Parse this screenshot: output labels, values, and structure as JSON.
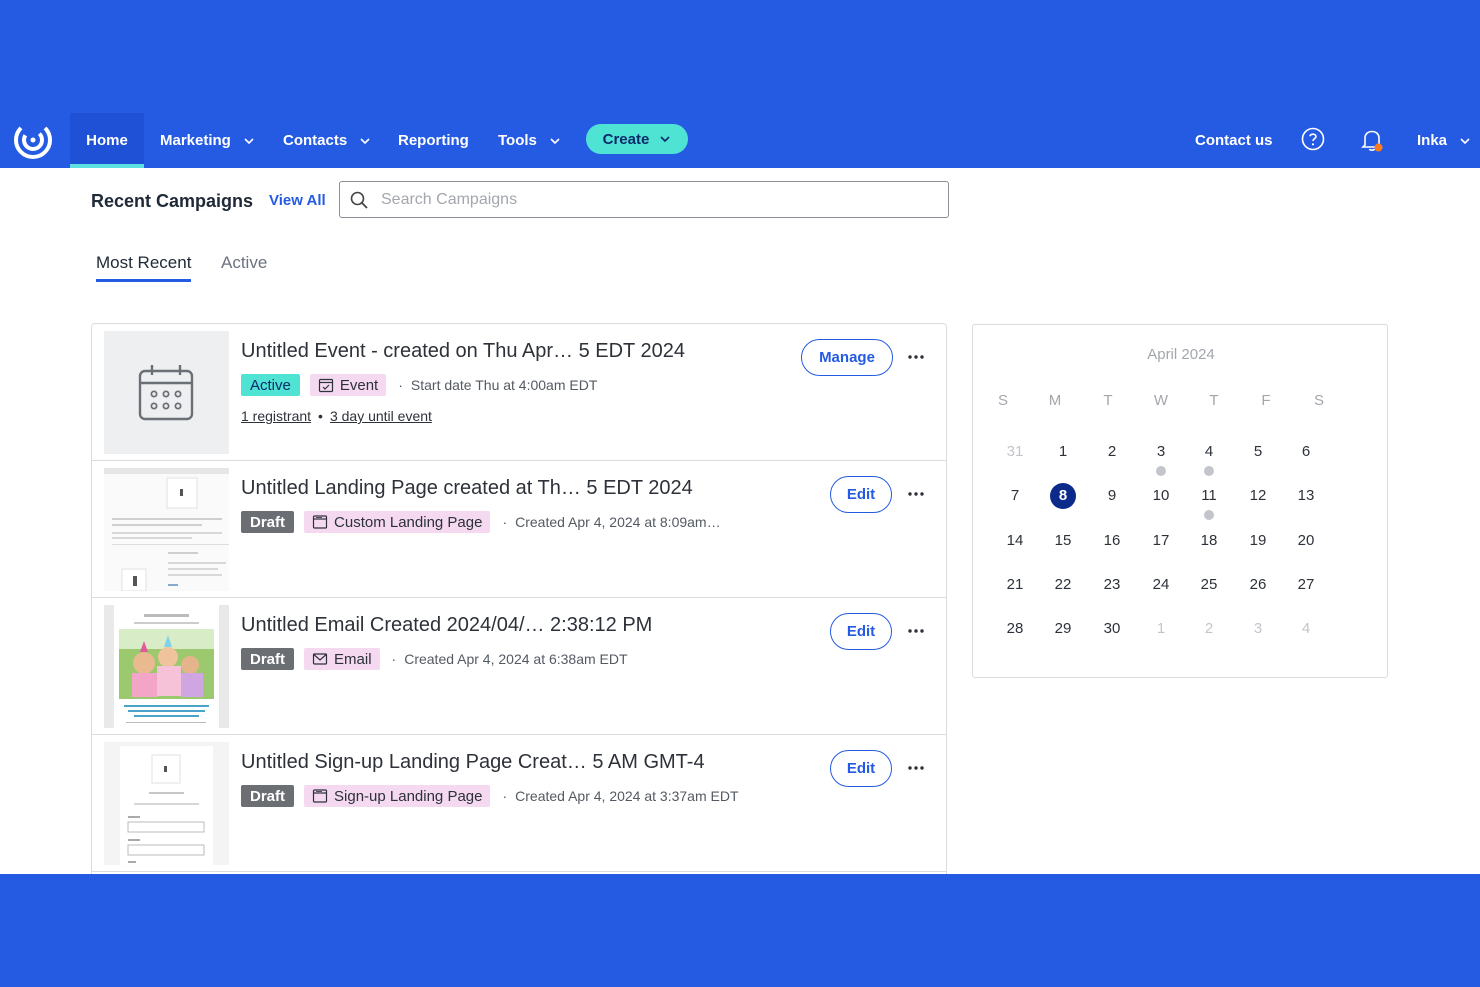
{
  "colors": {
    "brand": "#255be3",
    "accent": "#4fe3d4",
    "today": "#0b2a8a",
    "type_badge": "#f4d9f0",
    "draft_badge": "#6b6e73"
  },
  "nav": {
    "home": "Home",
    "marketing": "Marketing",
    "contacts": "Contacts",
    "reporting": "Reporting",
    "tools": "Tools",
    "create": "Create",
    "contact_us": "Contact us",
    "user": "Inka"
  },
  "recent": {
    "title": "Recent Campaigns",
    "view_all": "View All",
    "search_placeholder": "Search Campaigns"
  },
  "tabs": {
    "most_recent": "Most Recent",
    "active": "Active"
  },
  "campaigns": [
    {
      "title": "Untitled Event - created on Thu Apr… 5 EDT 2024",
      "status": "Active",
      "type": "Event",
      "type_icon": "calendar-check-icon",
      "meta": "Start date Thu at 4:00am EDT",
      "registrants": "1 registrant",
      "until": "3 day until event",
      "action": "Manage"
    },
    {
      "title": "Untitled Landing Page created at Th…  5 EDT 2024",
      "status": "Draft",
      "type": "Custom Landing Page",
      "type_icon": "browser-window-icon",
      "meta": "Created Apr 4, 2024 at 8:09am…",
      "action": "Edit"
    },
    {
      "title": "Untitled Email Created 2024/04/…  2:38:12 PM",
      "status": "Draft",
      "type": "Email",
      "type_icon": "envelope-icon",
      "meta": "Created Apr 4, 2024 at 6:38am EDT",
      "action": "Edit"
    },
    {
      "title": "Untitled Sign-up Landing Page Creat… 5 AM GMT-4",
      "status": "Draft",
      "type": "Sign-up Landing Page",
      "type_icon": "browser-window-icon",
      "meta": "Created Apr 4, 2024 at 3:37am EDT",
      "action": "Edit"
    }
  ],
  "calendar": {
    "month": "April 2024",
    "weekdays": [
      "S",
      "M",
      "T",
      "W",
      "T",
      "F",
      "S"
    ],
    "weeks": [
      [
        "31",
        "1",
        "2",
        "3",
        "4",
        "5",
        "6"
      ],
      [
        "7",
        "8",
        "9",
        "10",
        "11",
        "12",
        "13"
      ],
      [
        "14",
        "15",
        "16",
        "17",
        "18",
        "19",
        "20"
      ],
      [
        "21",
        "22",
        "23",
        "24",
        "25",
        "26",
        "27"
      ],
      [
        "28",
        "29",
        "30",
        "1",
        "2",
        "3",
        "4"
      ]
    ],
    "today": "8",
    "event_days": [
      "3",
      "4",
      "11"
    ]
  }
}
